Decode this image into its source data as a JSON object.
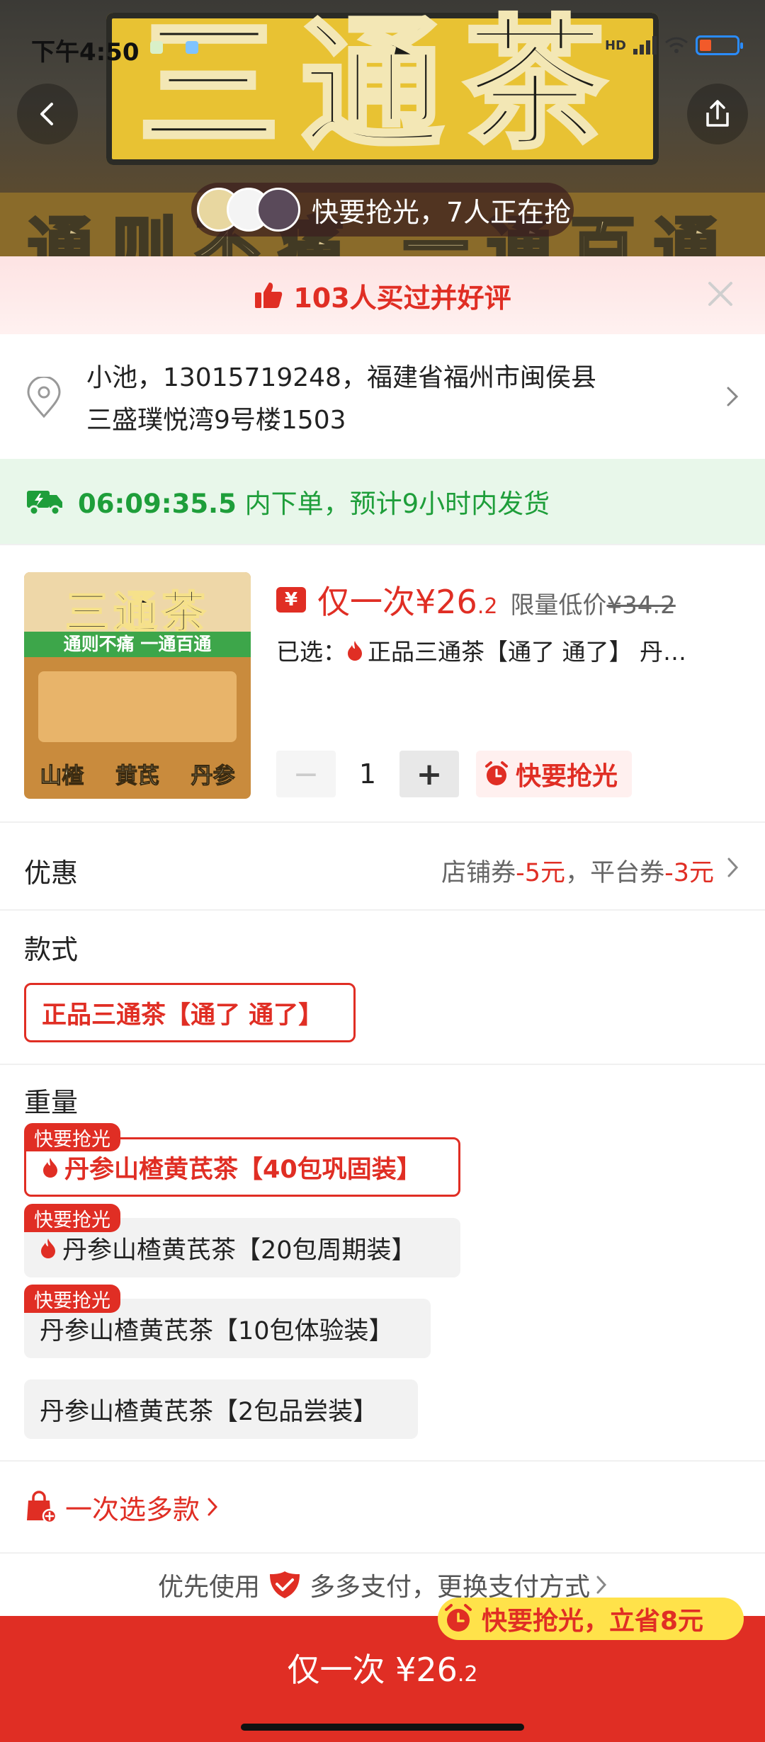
{
  "status_bar": {
    "time": "下午4:50",
    "network": "HD"
  },
  "hero": {
    "title": "三通茶",
    "subtitle": "通则不痛 一通百通",
    "grab_text": "快要抢光，7人正在抢"
  },
  "reviews_banner": {
    "text": "103人买过并好评"
  },
  "address": {
    "line1": "小池，13015719248，福建省福州市闽侯县",
    "line2": "三盛璞悦湾9号楼1503"
  },
  "shipping": {
    "countdown": "06:09:35.5",
    "text": " 内下单，预计9小时内发货"
  },
  "product": {
    "thumb_title": "三通茶",
    "thumb_slogan": "通则不痛  一通百通",
    "thumb_labels": [
      "山楂",
      "黄芪",
      "丹参"
    ],
    "price_badge": "¥",
    "price_prefix": "仅一次¥26",
    "price_cents": ".2",
    "price_label": "限量低价",
    "price_old": "¥34.2",
    "selected_label": "已选：",
    "selected_value": "正品三通茶【通了 通了】 丹…",
    "quantity": "1",
    "minus_label": "−",
    "plus_label": "+",
    "hurry_label": "快要抢光"
  },
  "discount": {
    "label": "优惠",
    "shop_coupon_label": "店铺券",
    "shop_coupon_value": "-5元",
    "separator": "，",
    "platform_coupon_label": "平台券",
    "platform_coupon_value": "-3元"
  },
  "style": {
    "label": "款式",
    "options": [
      {
        "label": "正品三通茶【通了 通了】",
        "selected": true
      }
    ]
  },
  "weight": {
    "label": "重量",
    "options": [
      {
        "label": "丹参山楂黄芪茶【40包巩固装】",
        "badge": "快要抢光",
        "hot": true,
        "selected": true
      },
      {
        "label": "丹参山楂黄芪茶【20包周期装】",
        "badge": "快要抢光",
        "hot": true,
        "selected": false
      },
      {
        "label": "丹参山楂黄芪茶【10包体验装】",
        "badge": "快要抢光",
        "hot": false,
        "selected": false
      },
      {
        "label": "丹参山楂黄芪茶【2包品尝装】",
        "badge": "",
        "hot": false,
        "selected": false
      }
    ]
  },
  "multi_select": {
    "label": "一次选多款"
  },
  "payment_hint": {
    "prefix": "优先使用",
    "middle": "多多支付，更换支付方式"
  },
  "buy_bar": {
    "label": "仅一次 ¥26",
    "cents": ".2",
    "save_pill": "快要抢光，立省8元"
  },
  "colors": {
    "brand_red": "#e02e24",
    "ship_green": "#1e9e3a",
    "pill_yellow": "#ffe24a"
  },
  "icons": [
    "back-icon",
    "share-icon",
    "thumbs-up-icon",
    "close-icon",
    "location-pin-icon",
    "chevron-right-icon",
    "delivery-truck-icon",
    "fire-icon",
    "alarm-clock-icon",
    "shopping-bag-plus-icon",
    "shield-check-icon"
  ]
}
